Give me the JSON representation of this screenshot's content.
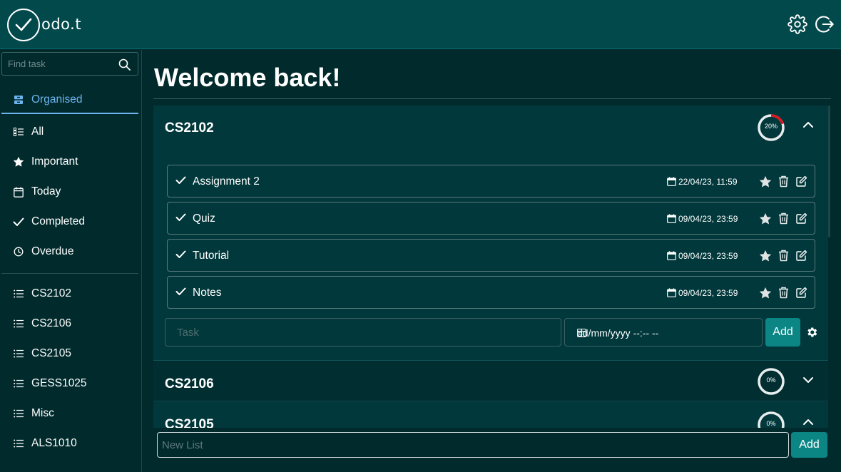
{
  "app": {
    "logo_text": "odo.t"
  },
  "sidebar": {
    "search_placeholder": "Find task",
    "views": [
      {
        "label": "Organised",
        "icon": "organised-icon",
        "active": true
      },
      {
        "label": "All",
        "icon": "list-all-icon"
      },
      {
        "label": "Important",
        "icon": "star-icon"
      },
      {
        "label": "Today",
        "icon": "calendar-icon"
      },
      {
        "label": "Completed",
        "icon": "check-icon"
      },
      {
        "label": "Overdue",
        "icon": "clock-icon"
      }
    ],
    "lists": [
      {
        "label": "CS2102"
      },
      {
        "label": "CS2106"
      },
      {
        "label": "CS2105"
      },
      {
        "label": "GESS1025"
      },
      {
        "label": "Misc"
      },
      {
        "label": "ALS1010"
      }
    ]
  },
  "main": {
    "welcome": "Welcome back!",
    "lists": [
      {
        "title": "CS2102",
        "progress_text": "20%",
        "progress": 0.2,
        "expanded": true,
        "tasks": [
          {
            "name": "Assignment 2",
            "due": "22/04/23, 11:59"
          },
          {
            "name": "Quiz",
            "due": "09/04/23, 23:59"
          },
          {
            "name": "Tutorial",
            "due": "09/04/23, 23:59"
          },
          {
            "name": "Notes",
            "due": "09/04/23, 23:59"
          }
        ],
        "task_placeholder": "Task",
        "date_placeholder": "dd/mm/yyyy  --:--  --",
        "add_label": "Add"
      },
      {
        "title": "CS2106",
        "progress_text": "0%",
        "progress": 0,
        "expanded": false
      },
      {
        "title": "CS2105",
        "progress_text": "0%",
        "progress": 0,
        "expanded": true
      }
    ],
    "new_list_placeholder": "New List",
    "new_list_add_label": "Add"
  },
  "colors": {
    "header_bg": "#02494c",
    "page_bg": "#012a2c",
    "card_bg": "#01383b",
    "accent": "#6cb4ee",
    "button": "#0c8585",
    "progress": "#e0141e"
  }
}
